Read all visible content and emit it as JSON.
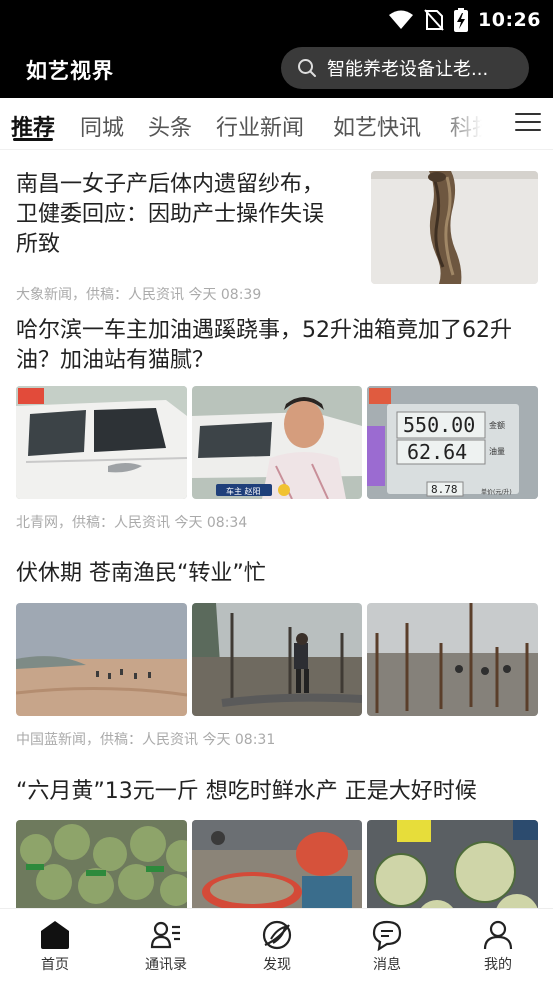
{
  "status_bar": {
    "time": "10:26"
  },
  "header": {
    "brand": "如艺视界",
    "search": {
      "text": "智能养老设备让老..."
    }
  },
  "tabs": [
    {
      "label": "推荐",
      "active": true
    },
    {
      "label": "同城"
    },
    {
      "label": "头条"
    },
    {
      "label": "行业新闻"
    },
    {
      "label": "如艺快讯"
    },
    {
      "label": "科技"
    }
  ],
  "articles": [
    {
      "title": "南昌一女子产后体内遗留纱布，卫健委回应：因助产士操作失误所致",
      "meta": "大象新闻，供稿：人民资讯 今天 08:39"
    },
    {
      "title": "哈尔滨一车主加油遇蹊跷事，52升油箱竟加了62升油？加油站有猫腻？",
      "meta": "北青网，供稿：人民资讯 今天 08:34",
      "image_text": {
        "pump_top": "550.00",
        "pump_mid": "62.64",
        "pump_price": "8.78",
        "pump_label_1": "金额",
        "pump_label_2": "油量",
        "pump_label_3": "单价(元/升)",
        "caption": "车主 赵阳"
      }
    },
    {
      "title": "伏休期 苍南渔民“转业”忙",
      "meta": "中国蓝新闻，供稿：人民资讯 今天 08:31"
    },
    {
      "title": "“六月黄”13元一斤 想吃时鲜水产 正是大好时候",
      "meta": ""
    }
  ],
  "bottom_nav": [
    {
      "label": "首页",
      "icon": "home-icon",
      "active": true
    },
    {
      "label": "通讯录",
      "icon": "contacts-icon"
    },
    {
      "label": "发现",
      "icon": "discover-icon"
    },
    {
      "label": "消息",
      "icon": "message-icon"
    },
    {
      "label": "我的",
      "icon": "profile-icon"
    }
  ],
  "colors": {
    "header_bg": "#000000",
    "search_bg": "#3a3a3a",
    "meta_text": "#aaaaaa",
    "active_text": "#111111"
  }
}
